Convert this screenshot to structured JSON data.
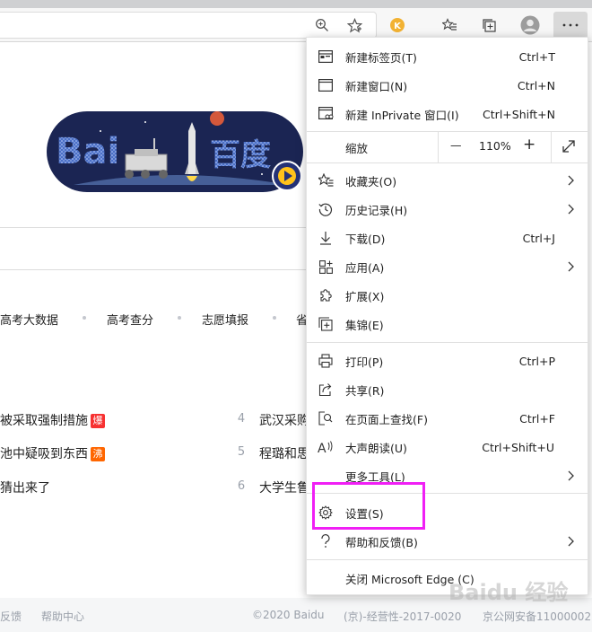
{
  "toolbar": {
    "icons": [
      "zoom-icon",
      "favorite-star-icon",
      "extension-icon",
      "favorites-list-icon",
      "collections-icon",
      "profile-icon",
      "more-menu-icon"
    ]
  },
  "hot_links": [
    "高考大数据",
    "高考查分",
    "志愿填报",
    "省"
  ],
  "news": {
    "left": [
      {
        "text": "被采取强制措施",
        "badge": "爆",
        "badge_color": "#f73131"
      },
      {
        "text": "池中疑吸到东西",
        "badge": "沸",
        "badge_color": "#ff6600"
      },
      {
        "text": "猜出来了",
        "badge": ""
      }
    ],
    "right": [
      {
        "num": "4",
        "text": "武汉采购"
      },
      {
        "num": "5",
        "text": "程璐和思"
      },
      {
        "num": "6",
        "text": "大学生鲁"
      }
    ]
  },
  "footer": {
    "left": [
      "反馈",
      "帮助中心"
    ],
    "copyright": "©2020 Baidu",
    "icp": "(京)-经营性-2017-0020",
    "police": "京公网安备11000002"
  },
  "menu": {
    "items": [
      {
        "label": "新建标签页(T)",
        "shortcut": "Ctrl+T",
        "icon": "new-tab-icon"
      },
      {
        "label": "新建窗口(N)",
        "shortcut": "Ctrl+N",
        "icon": "new-window-icon"
      },
      {
        "label": "新建 InPrivate 窗口(I)",
        "shortcut": "Ctrl+Shift+N",
        "icon": "inprivate-icon"
      },
      {
        "label": "缩放",
        "icon": ""
      },
      {
        "label": "收藏夹(O)",
        "icon": "favorites-icon"
      },
      {
        "label": "历史记录(H)",
        "icon": "history-icon"
      },
      {
        "label": "下载(D)",
        "shortcut": "Ctrl+J",
        "icon": "download-icon"
      },
      {
        "label": "应用(A)",
        "icon": "apps-icon"
      },
      {
        "label": "扩展(X)",
        "icon": "extensions-icon"
      },
      {
        "label": "集锦(E)",
        "icon": "collections-icon"
      },
      {
        "label": "打印(P)",
        "shortcut": "Ctrl+P",
        "icon": "print-icon"
      },
      {
        "label": "共享(R)",
        "icon": "share-icon"
      },
      {
        "label": "在页面上查找(F)",
        "shortcut": "Ctrl+F",
        "icon": "find-icon"
      },
      {
        "label": "大声朗读(U)",
        "shortcut": "Ctrl+Shift+U",
        "icon": "read-aloud-icon"
      },
      {
        "label": "更多工具(L)",
        "icon": ""
      },
      {
        "label": "设置(S)",
        "icon": "settings-icon"
      },
      {
        "label": "帮助和反馈(B)",
        "icon": "help-icon"
      },
      {
        "label": "关闭 Microsoft Edge (C)",
        "icon": ""
      }
    ],
    "zoom": {
      "minus": "—",
      "value": "110%",
      "plus": "+"
    }
  },
  "baidu_logo_text": {
    "left": "Bai",
    "right": "百度"
  },
  "watermark": "Baidu 经验",
  "colors": {
    "highlight": "#f01ff5",
    "accent_badge_hot": "#f73131",
    "accent_badge_boil": "#ff6600",
    "logo_bg": "#1b2553"
  }
}
